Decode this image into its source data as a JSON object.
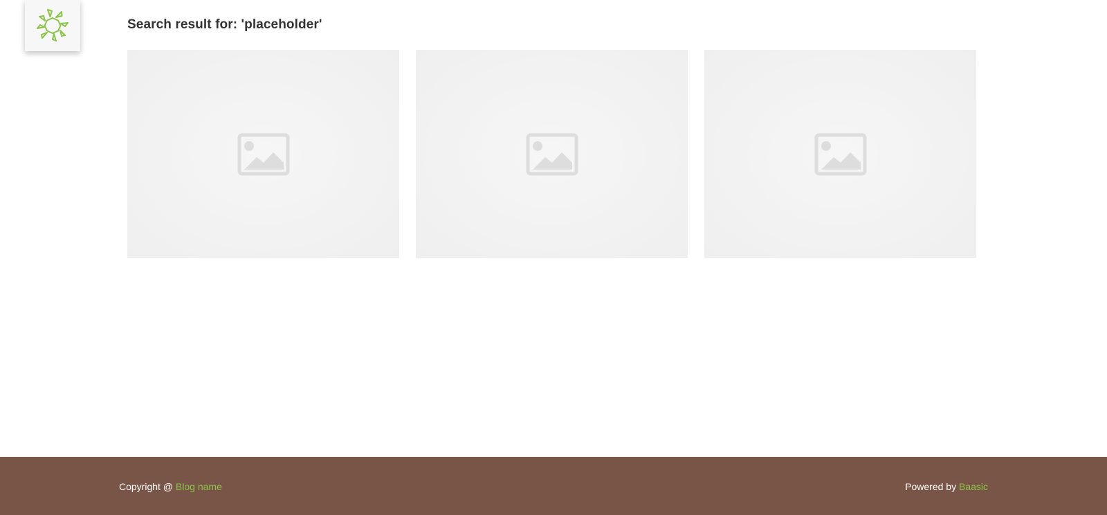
{
  "logo": {
    "icon": "sun-logo-icon",
    "color": "#8bc34a"
  },
  "search": {
    "title": "Search result for: 'placeholder'"
  },
  "results": [
    {
      "icon": "image-placeholder-icon"
    },
    {
      "icon": "image-placeholder-icon"
    },
    {
      "icon": "image-placeholder-icon"
    }
  ],
  "footer": {
    "copyright_prefix": "Copyright @ ",
    "blog_link": "Blog name",
    "powered_prefix": "Powered by ",
    "powered_link": "Baasic",
    "background": "#795548",
    "link_color": "#8bc34a"
  }
}
